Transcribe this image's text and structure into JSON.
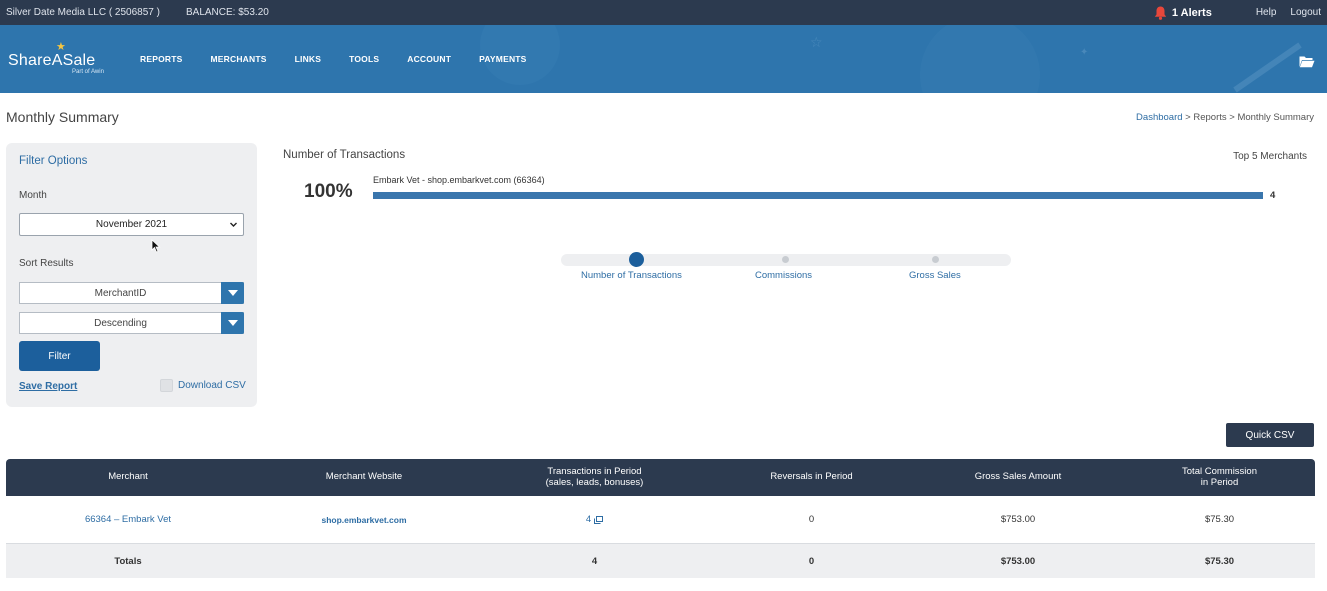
{
  "topbar": {
    "account": "Silver Date Media LLC ( 2506857 )",
    "balance": "BALANCE: $53.20",
    "alerts": "1 Alerts",
    "help": "Help",
    "logout": "Logout"
  },
  "header": {
    "logo_name": "ShareASale",
    "logo_sub": "Part of Awin",
    "nav": [
      "REPORTS",
      "MERCHANTS",
      "LINKS",
      "TOOLS",
      "ACCOUNT",
      "PAYMENTS"
    ]
  },
  "page": {
    "title": "Monthly Summary",
    "breadcrumb": {
      "dashboard": "Dashboard",
      "rest": " > Reports > Monthly Summary"
    }
  },
  "filter": {
    "title": "Filter Options",
    "month_label": "Month",
    "month_value": "November 2021",
    "sort_label": "Sort Results",
    "sort_field": "MerchantID",
    "sort_order": "Descending",
    "filter_button": "Filter",
    "save_report": "Save Report",
    "download_csv": "Download CSV"
  },
  "chart": {
    "title": "Number of Transactions",
    "top5_label": "Top 5 Merchants",
    "percent": "100%",
    "bar_label": "Embark Vet - shop.embarkvet.com (66364)",
    "bar_value": "4",
    "steps": [
      "Number of Transactions",
      "Commissions",
      "Gross Sales"
    ]
  },
  "chart_data": {
    "type": "bar",
    "categories": [
      "Embark Vet - shop.embarkvet.com (66364)"
    ],
    "values": [
      4
    ],
    "title": "Number of Transactions"
  },
  "quick_csv": "Quick CSV",
  "table": {
    "headers": [
      "Merchant",
      "Merchant Website",
      "Transactions in Period\n(sales, leads, bonuses)",
      "Reversals in Period",
      "Gross Sales Amount",
      "Total Commission\nin Period"
    ],
    "rows": [
      {
        "merchant": "66364 – Embark Vet",
        "website": "shop.embarkvet.com",
        "transactions": "4",
        "reversals": "0",
        "gross": "$753.00",
        "commission": "$75.30"
      }
    ],
    "totals": {
      "label": "Totals",
      "website": "",
      "transactions": "4",
      "reversals": "0",
      "gross": "$753.00",
      "commission": "$75.30"
    }
  },
  "colors": {
    "topbar": "#2c3a4f",
    "header": "#2e75ad",
    "accent": "#1c5f9c",
    "alert_bell": "#e8473b",
    "star": "#f5c542"
  }
}
